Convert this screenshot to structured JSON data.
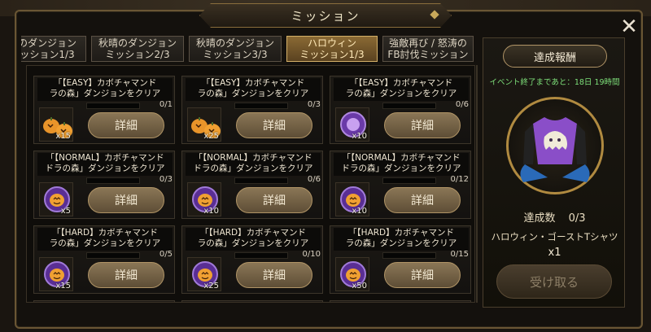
{
  "title": "ミッション",
  "tabs": [
    {
      "label": "のダンジョン\nッション1/3"
    },
    {
      "label": "秋晴のダンジョン\nミッション2/3"
    },
    {
      "label": "秋晴のダンジョン\nミッション3/3"
    },
    {
      "label": "ハロウィン\nミッション1/3",
      "active": true
    },
    {
      "label": "強敵再び / 怒涛の\nFB討伐ミッション"
    }
  ],
  "missions": [
    {
      "title": "「【EASY】カボチャマンド\nラの森」ダンジョンをクリア",
      "progress": "0/1",
      "progress_fraction": 0,
      "item_icon": "pumpkin-icon",
      "qty": "x15",
      "button": "詳細"
    },
    {
      "title": "「【EASY】カボチャマンド\nラの森」ダンジョンをクリア",
      "progress": "0/3",
      "progress_fraction": 0,
      "item_icon": "pumpkin-icon",
      "qty": "x25",
      "button": "詳細"
    },
    {
      "title": "「【EASY】カボチャマンド\nラの森」ダンジョンをクリア",
      "progress": "0/6",
      "progress_fraction": 0,
      "item_icon": "purple-orb-icon",
      "qty": "x10",
      "button": "詳細"
    },
    {
      "title": "「【NORMAL】カボチャマンド\nドラの森」ダンジョンをクリア",
      "progress": "0/3",
      "progress_fraction": 0,
      "item_icon": "pumpkin-orb-icon",
      "qty": "x5",
      "button": "詳細"
    },
    {
      "title": "「【NORMAL】カボチャマンド\nドラの森」ダンジョンをクリア",
      "progress": "0/6",
      "progress_fraction": 0,
      "item_icon": "pumpkin-orb-icon",
      "qty": "x10",
      "button": "詳細"
    },
    {
      "title": "「【NORMAL】カボチャマンド\nドラの森」ダンジョンをクリア",
      "progress": "0/12",
      "progress_fraction": 0,
      "item_icon": "pumpkin-orb-icon",
      "qty": "x10",
      "button": "詳細"
    },
    {
      "title": "「【HARD】カボチャマンド\nラの森」ダンジョンをクリア",
      "progress": "0/5",
      "progress_fraction": 0,
      "item_icon": "pumpkin-orb-icon",
      "qty": "x15",
      "button": "詳細"
    },
    {
      "title": "「【HARD】カボチャマンド\nラの森」ダンジョンをクリア",
      "progress": "0/10",
      "progress_fraction": 0,
      "item_icon": "pumpkin-orb-icon",
      "qty": "x25",
      "button": "詳細"
    },
    {
      "title": "「【HARD】カボチャマンド\nラの森」ダンジョンをクリア",
      "progress": "0/15",
      "progress_fraction": 0,
      "item_icon": "pumpkin-orb-icon",
      "qty": "x50",
      "button": "詳細"
    }
  ],
  "reward": {
    "header": "達成報酬",
    "event_time": "イベント終了まであと：18日 19時間",
    "icon": "halloween-ghost-tshirt-icon",
    "count_label": "達成数",
    "count_value": "0/3",
    "name": "ハロウィン・ゴーストTシャツ",
    "qty": "x1",
    "claim_button": "受け取る"
  },
  "colors": {
    "gold": "#c9a95a",
    "event_green": "#7ee07a",
    "pumpkin": "#e8942a",
    "purple": "#8a4ec8"
  }
}
